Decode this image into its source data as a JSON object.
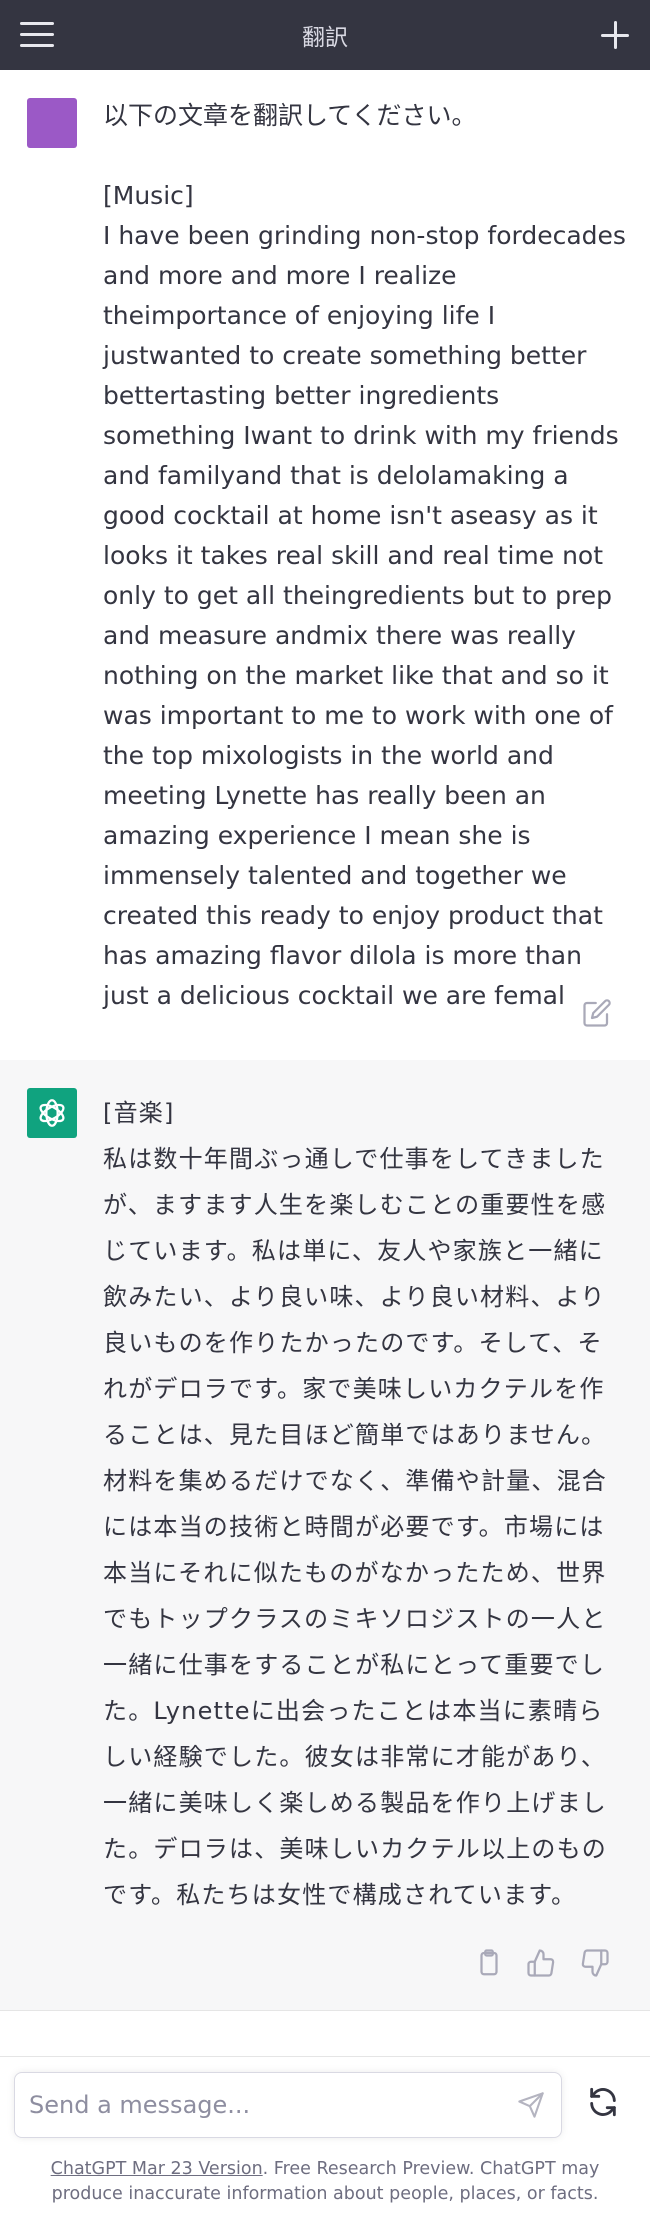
{
  "header": {
    "title": "翻訳"
  },
  "icons": {
    "menu": "hamburger-menu-icon",
    "new_chat": "plus-icon",
    "edit": "edit-pencil-icon",
    "assistant_avatar": "openai-logo-icon",
    "copy": "clipboard-icon",
    "thumbs_up": "thumbs-up-icon",
    "thumbs_down": "thumbs-down-icon",
    "send": "paper-plane-icon",
    "regenerate": "refresh-icon"
  },
  "colors": {
    "topbar": "#343541",
    "user_avatar": "#9b59c6",
    "assistant_avatar": "#10a37f",
    "assistant_bg": "#f7f7f8"
  },
  "user_message": {
    "text": "以下の文章を翻訳してください。\n\n[Music]\nI have been grinding non-stop fordecades and more and more I realize theimportance of enjoying life I justwanted to create something better bettertasting better ingredients something Iwant to drink with my friends and familyand that is delolamaking a good cocktail at home isn't aseasy as it looks it takes real skill and real time not only to get all theingredients but to prep and measure andmix there was really nothing on the market like that and so it was important to me to work with one of the top mixologists in the world and meeting Lynette has really been an amazing experience I mean she is immensely talented and together we created this ready to enjoy product that has amazing flavor dilola is more than just a delicious cocktail we are femal"
  },
  "assistant_message": {
    "text": "[音楽]\n私は数十年間ぶっ通しで仕事をしてきましたが、ますます人生を楽しむことの重要性を感じています。私は単に、友人や家族と一緒に飲みたい、より良い味、より良い材料、より良いものを作りたかったのです。そして、それがデロラです。家で美味しいカクテルを作ることは、見た目ほど簡単ではありません。材料を集めるだけでなく、準備や計量、混合には本当の技術と時間が必要です。市場には本当にそれに似たものがなかったため、世界でもトップクラスのミキソロジストの一人と一緒に仕事をすることが私にとって重要でした。Lynetteに出会ったことは本当に素晴らしい経験でした。彼女は非常に才能があり、一緒に美味しく楽しめる製品を作り上げました。デロラは、美味しいカクテル以上のものです。私たちは女性で構成されています。"
  },
  "composer": {
    "placeholder": "Send a message...",
    "value": ""
  },
  "footer": {
    "version_link": "ChatGPT Mar 23 Version",
    "note": ". Free Research Preview. ChatGPT may produce inaccurate information about people, places, or facts."
  }
}
